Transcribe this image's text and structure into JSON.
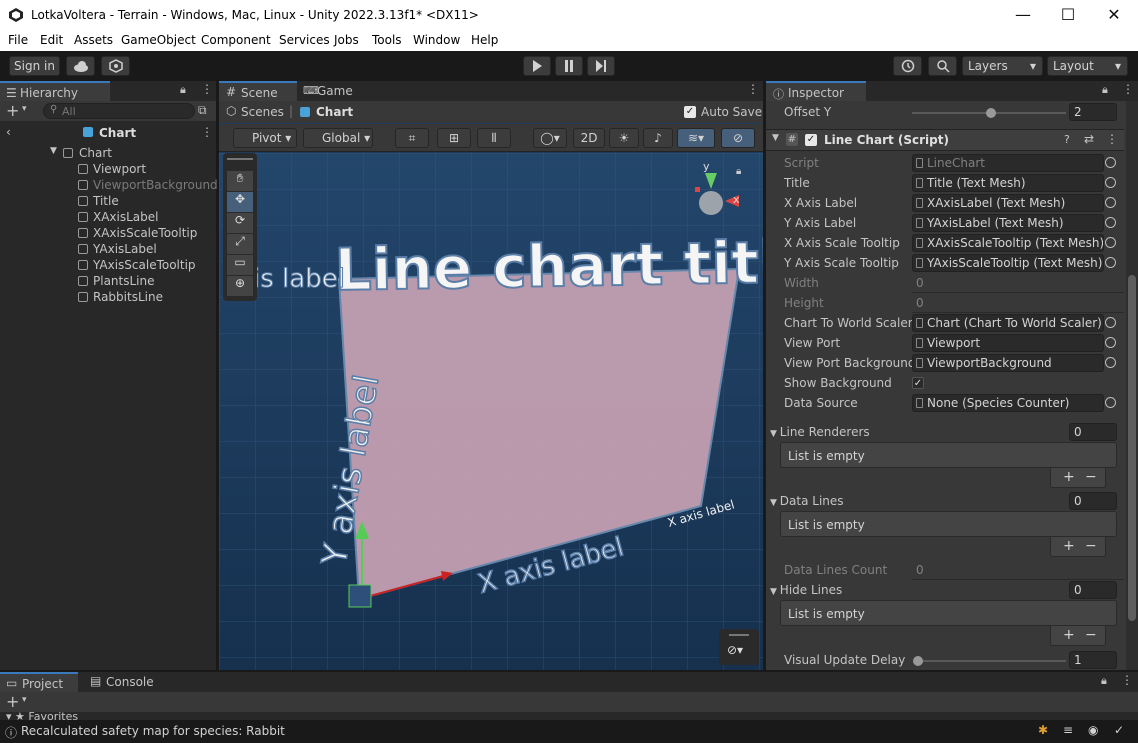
{
  "window": {
    "title": "LotkaVoltera - Terrain - Windows, Mac, Linux - Unity 2022.3.13f1* <DX11>",
    "minimize": "—",
    "maximize": "☐",
    "close": "✕"
  },
  "menu": [
    "File",
    "Edit",
    "Assets",
    "GameObject",
    "Component",
    "Services",
    "Jobs",
    "Tools",
    "Window",
    "Help"
  ],
  "toolbar": {
    "sign_in": "Sign in",
    "layers": "Layers",
    "layout": "Layout"
  },
  "hierarchy": {
    "tab": "Hierarchy",
    "search_placeholder": "All",
    "breadcrumb": "Chart",
    "items": [
      {
        "label": "Chart",
        "level": 0
      },
      {
        "label": "Viewport",
        "level": 1
      },
      {
        "label": "ViewportBackground",
        "level": 1,
        "inactive": true
      },
      {
        "label": "Title",
        "level": 1
      },
      {
        "label": "XAxisLabel",
        "level": 1
      },
      {
        "label": "XAxisScaleTooltip",
        "level": 1
      },
      {
        "label": "YAxisLabel",
        "level": 1
      },
      {
        "label": "YAxisScaleTooltip",
        "level": 1
      },
      {
        "label": "PlantsLine",
        "level": 1
      },
      {
        "label": "RabbitsLine",
        "level": 1
      }
    ]
  },
  "scene": {
    "tabs": [
      "Scene",
      "Game"
    ],
    "breadcrumb_root": "Scenes",
    "breadcrumb_leaf": "Chart",
    "auto_save": "Auto Save",
    "pivot": "Pivot",
    "global": "Global",
    "mode_2d": "2D",
    "chart_title": "Line chart title",
    "y_axis_label": "Y axis label",
    "x_axis_label": "X axis label",
    "x_axis_label_small": "X axis label",
    "stray_label": "is label",
    "gizmo_y": "y",
    "gizmo_x": "x"
  },
  "inspector": {
    "tab": "Inspector",
    "offset_y_label": "Offset Y",
    "offset_y_value": "2",
    "component": "Line Chart (Script)",
    "fields": [
      {
        "label": "Script",
        "value": "LineChart",
        "dim": true
      },
      {
        "label": "Title",
        "value": "Title (Text Mesh)"
      },
      {
        "label": "X Axis Label",
        "value": "XAxisLabel (Text Mesh)"
      },
      {
        "label": "Y Axis Label",
        "value": "YAxisLabel (Text Mesh)"
      },
      {
        "label": "X Axis Scale Tooltip",
        "value": "XAxisScaleTooltip (Text Mesh)"
      },
      {
        "label": "Y Axis Scale Tooltip",
        "value": "YAxisScaleTooltip (Text Mesh)"
      },
      {
        "label": "Width",
        "value": "0",
        "dim": true
      },
      {
        "label": "Height",
        "value": "0",
        "dim": true
      },
      {
        "label": "Chart To World Scaler",
        "value": "Chart (Chart To World Scaler)"
      },
      {
        "label": "View Port",
        "value": "Viewport"
      },
      {
        "label": "View Port Background",
        "value": "ViewportBackground"
      },
      {
        "label": "Show Background",
        "value": "✓"
      },
      {
        "label": "Data Source",
        "value": "None (Species Counter)"
      }
    ],
    "line_renderers": {
      "label": "Line Renderers",
      "count": "0",
      "empty": "List is empty"
    },
    "data_lines": {
      "label": "Data Lines",
      "count": "0",
      "empty": "List is empty"
    },
    "data_lines_count": {
      "label": "Data Lines Count",
      "value": "0"
    },
    "hide_lines": {
      "label": "Hide Lines",
      "count": "0",
      "empty": "List is empty"
    },
    "visual_update_delay": {
      "label": "Visual Update Delay",
      "value": "1"
    },
    "plus": "+",
    "minus": "−"
  },
  "bottom": {
    "tabs": [
      "Project",
      "Console"
    ],
    "favorites": "Favorites"
  },
  "status": {
    "message": "Recalculated safety map for species: Rabbit"
  },
  "colors": {
    "accent": "#3a79bb",
    "panel": "#383838",
    "dark": "#191919"
  }
}
